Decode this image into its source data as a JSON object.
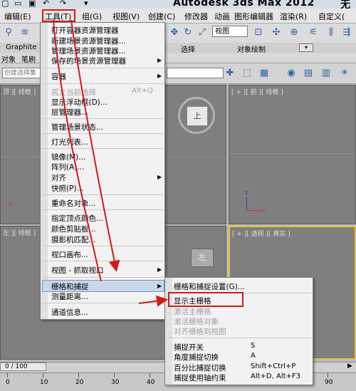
{
  "title_bar": {
    "app_title": "Autodesk 3ds Max  2012",
    "extra": "无"
  },
  "menubar": {
    "items": [
      "编辑(E)",
      "工具(T)",
      "组(G)",
      "视图(V)",
      "创建(C)",
      "修改器",
      "动画",
      "图形编辑器",
      "渲染(R)",
      "自定义("
    ]
  },
  "toolbar": {
    "view_select": "视图"
  },
  "ribbon": {
    "tabs": [
      "Graphite",
      "选择",
      "对象绘制"
    ],
    "row2": [
      "对象",
      "笔刷"
    ]
  },
  "toolbar2": {
    "selection_set_placeholder": "创建选择集"
  },
  "viewports": {
    "top": "[ + ][ 顶 ][ 线框 ]",
    "top_short": "顶 ][ 线框 ]",
    "front": "[ + ][ 前 ][ 线框 ]",
    "left": "左 ][ 线框 ]",
    "perspective": "[ + ][ 透视 ][ 真实 ]",
    "viewcube_top": "上",
    "viewcube_left": "左",
    "axis_x": "x",
    "axis_z": "z"
  },
  "timeline": {
    "slider": "0 / 100",
    "ticks": [
      "0",
      "10",
      "20",
      "30",
      "40",
      "50",
      "60",
      "70",
      "80",
      "90"
    ]
  },
  "tools_menu": {
    "items": [
      {
        "label": "打开容器资源管理器"
      },
      {
        "label": "新建场景资源管理器..."
      },
      {
        "label": "管理场景资源管理器..."
      },
      {
        "label": "保存的场景资源管理器"
      },
      {
        "label": "容器"
      },
      {
        "label": "孤立当前选择",
        "shortcut": "Alt+Q",
        "disabled": true
      },
      {
        "label": "显示浮动框(D)..."
      },
      {
        "label": "层管理器..."
      },
      {
        "label": "管理场景状态..."
      },
      {
        "label": "灯光列表..."
      },
      {
        "label": "镜像(M)..."
      },
      {
        "label": "阵列(A)..."
      },
      {
        "label": "对齐"
      },
      {
        "label": "快照(P)..."
      },
      {
        "label": "重命名对象..."
      },
      {
        "label": "指定顶点颜色..."
      },
      {
        "label": "颜色剪贴板..."
      },
      {
        "label": "摄影机匹配..."
      },
      {
        "label": "视口画布..."
      },
      {
        "label": "视图 - 抓取视口"
      },
      {
        "label": "栅格和捕捉"
      },
      {
        "label": "测量距离..."
      },
      {
        "label": "通道信息..."
      }
    ]
  },
  "grids_submenu": {
    "items": [
      {
        "label": "栅格和捕捉设置(G)..."
      },
      {
        "label": "显示主栅格"
      },
      {
        "label": "激活主栅格",
        "disabled": true
      },
      {
        "label": "激活栅格对象",
        "disabled": true
      },
      {
        "label": "对齐栅格到视图",
        "disabled": true
      },
      {
        "label": "捕捉开关",
        "shortcut": "S"
      },
      {
        "label": "角度捕捉切换",
        "shortcut": "A"
      },
      {
        "label": "百分比捕捉切换",
        "shortcut": "Shift+Ctrl+P"
      },
      {
        "label": "捕捉使用轴约束",
        "shortcut": "Alt+D, Alt+F3"
      }
    ]
  },
  "colors": {
    "annotation_red": "#d21a1a",
    "highlight": "#c9d7ea",
    "active_viewport": "#e8c43a"
  }
}
